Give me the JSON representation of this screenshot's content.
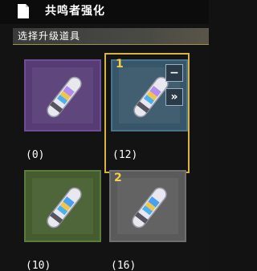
{
  "header": {
    "title": "共鸣者强化",
    "icon": "document-icon"
  },
  "section": {
    "title": "选择升级道具"
  },
  "items": [
    {
      "count_label": "(0)",
      "selected_count": "",
      "color": "#563b75",
      "selected": false
    },
    {
      "count_label": "(12)",
      "selected_count": "1",
      "color": "#37566a",
      "selected": true
    },
    {
      "count_label": "(10)",
      "selected_count": "",
      "color": "#445c2e",
      "selected": false
    },
    {
      "count_label": "(16)",
      "selected_count": "2",
      "color": "#5a5a5a",
      "selected": false
    }
  ],
  "controls": {
    "minus_label": "−",
    "max_label": "»"
  }
}
